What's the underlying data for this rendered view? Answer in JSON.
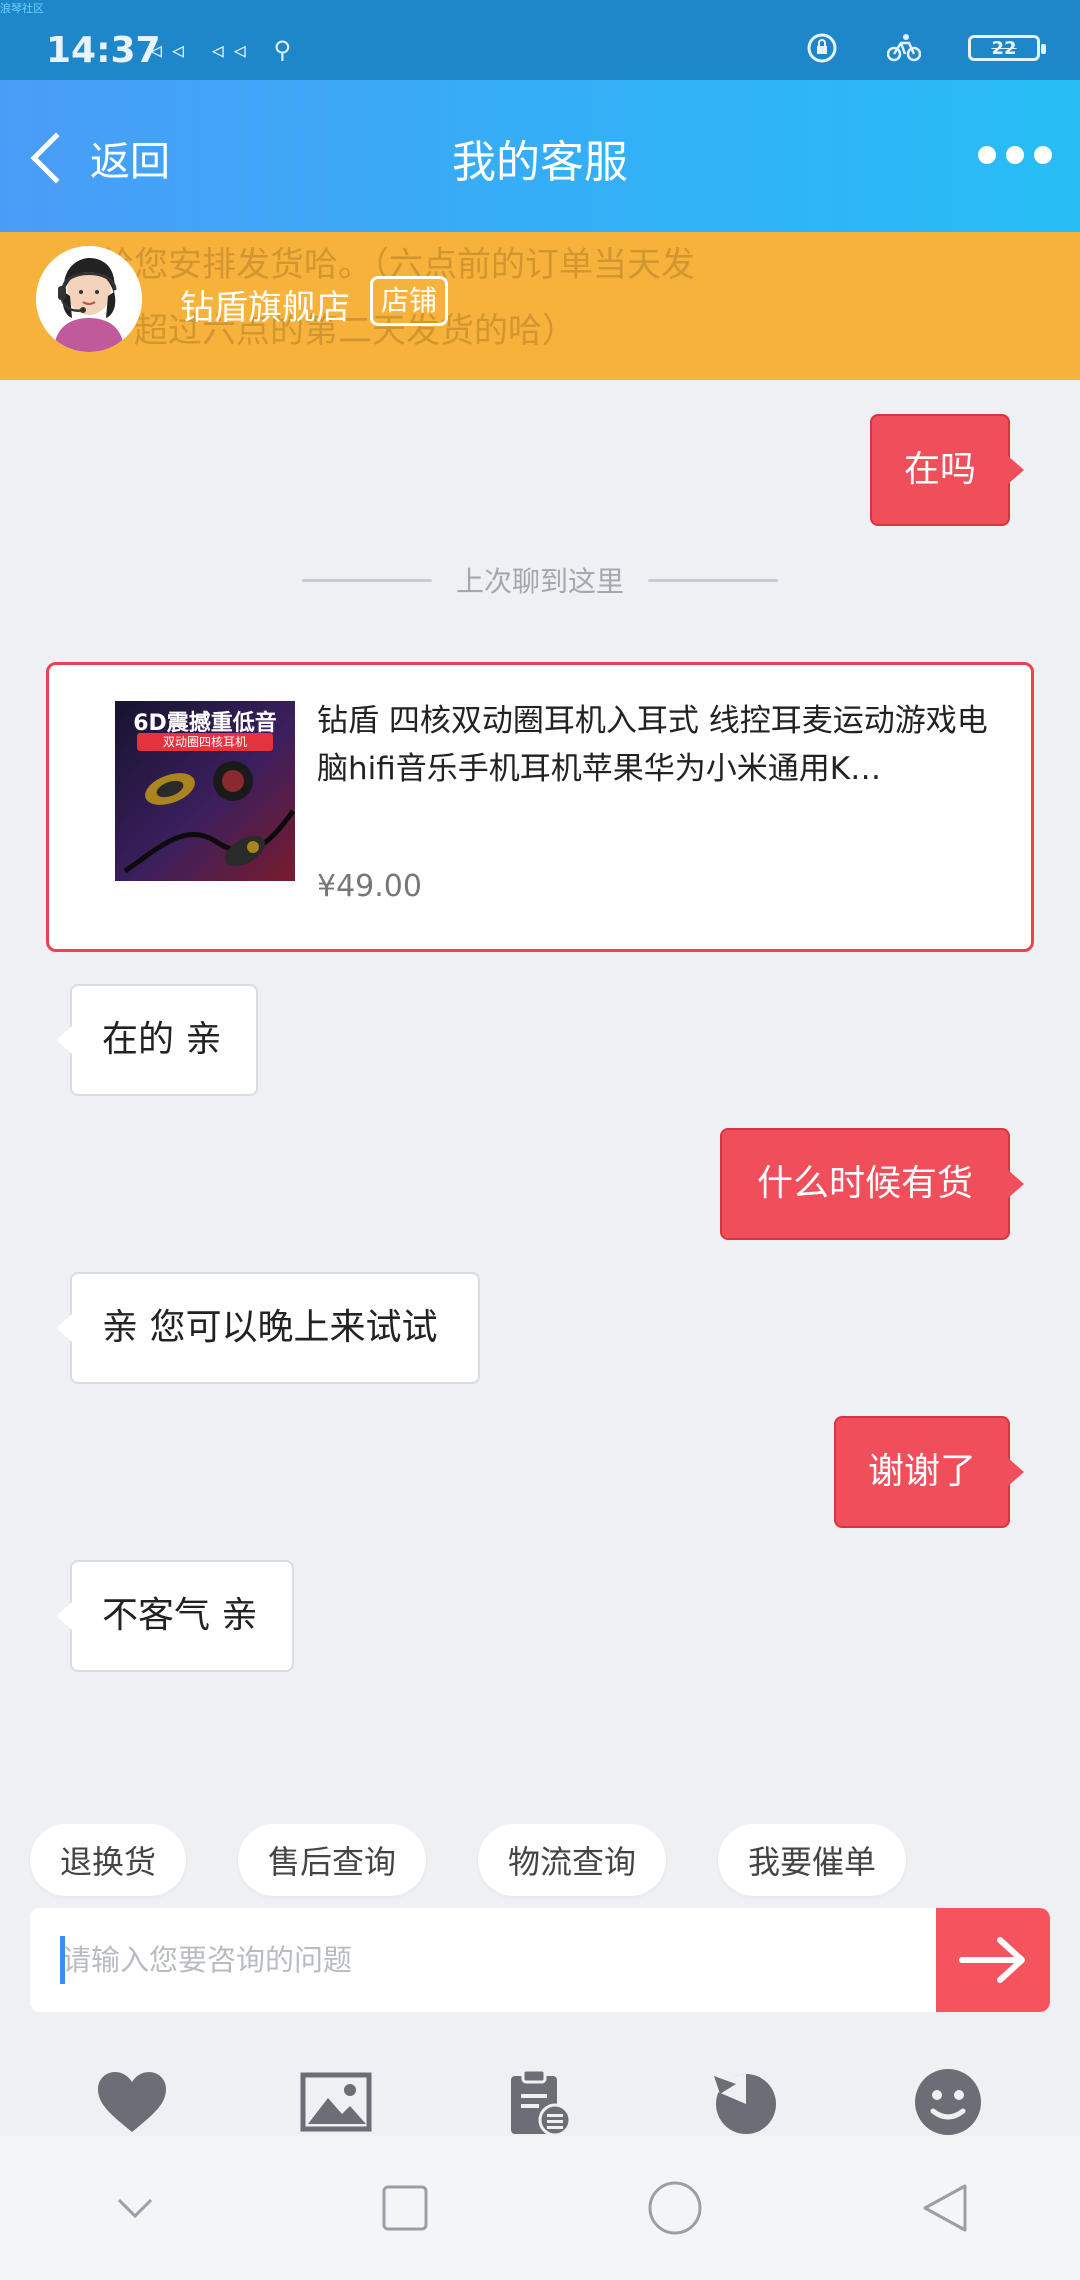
{
  "status_bar": {
    "carrier_label": "浪琴社区",
    "time": "14:37",
    "battery": "22"
  },
  "header": {
    "back_label": "返回",
    "title": "我的客服"
  },
  "store": {
    "ghost_line1": "给您安排发货哈。（六点前的订单当天发",
    "ghost_line2": "，超过六点的第二天发货的哈）",
    "name": "钻盾旗舰店",
    "store_button": "店铺"
  },
  "chat": {
    "divider": "上次聊到这里",
    "messages": [
      {
        "from": "me",
        "text": "在吗"
      },
      {
        "from": "them",
        "text": "在的 亲"
      },
      {
        "from": "me",
        "text": "什么时候有货"
      },
      {
        "from": "them",
        "text": "亲 您可以晚上来试试"
      },
      {
        "from": "me",
        "text": "谢谢了"
      },
      {
        "from": "them",
        "text": "不客气 亲"
      }
    ]
  },
  "product": {
    "image_text": "6D震撼重低音",
    "image_subtext": "双动圈四核耳机",
    "title": "钻盾 四核双动圈耳机入耳式 线控耳麦运动游戏电脑hifi音乐手机耳机苹果华为小米通用K…",
    "price": "¥49.00"
  },
  "quick_replies": [
    "退换货",
    "售后查询",
    "物流查询",
    "我要催单"
  ],
  "input": {
    "placeholder": "请输入您要咨询的问题",
    "value": ""
  },
  "tools": [
    "heart-icon",
    "image-icon",
    "clipboard-icon",
    "history-icon",
    "emoji-icon"
  ],
  "colors": {
    "header_start": "#4a9df5",
    "header_end": "#27bdf5",
    "store_bar": "#f6b23b",
    "my_bubble": "#f04e5a",
    "send_button": "#f5545f",
    "product_border": "#e8434f"
  }
}
